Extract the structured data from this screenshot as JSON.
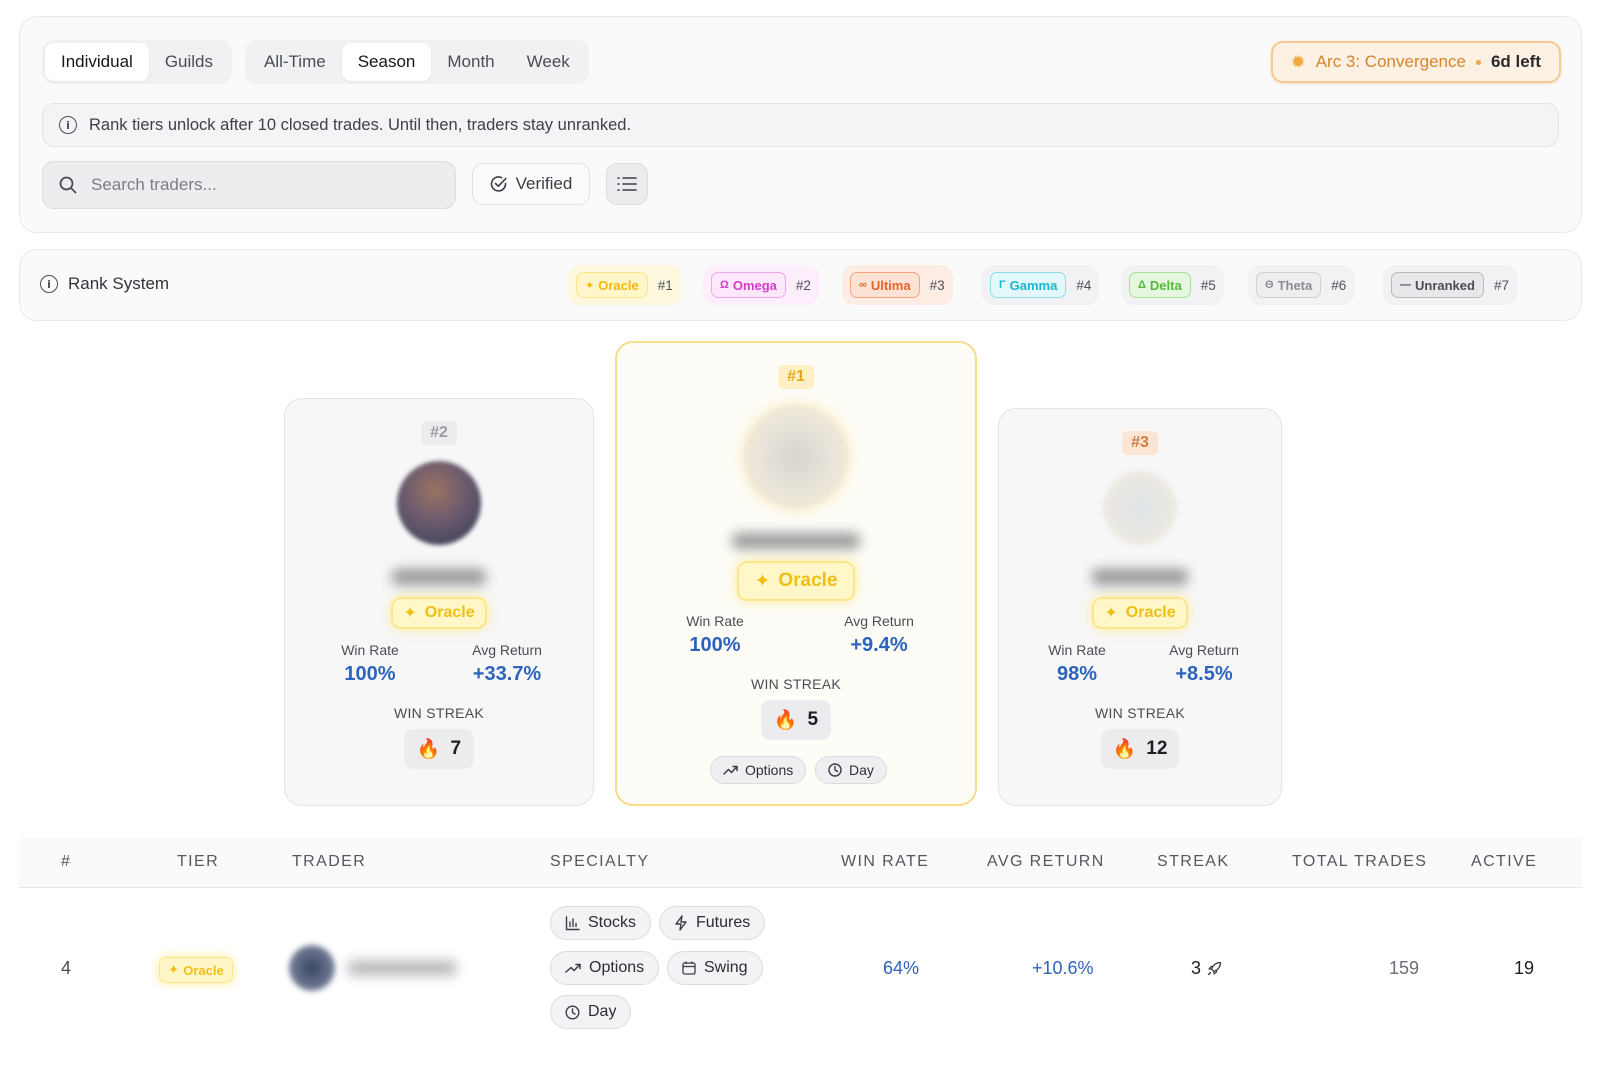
{
  "view_tabs": [
    "Individual",
    "Guilds"
  ],
  "view_active": 0,
  "period_tabs": [
    "All-Time",
    "Season",
    "Month",
    "Week"
  ],
  "period_active": 1,
  "arc": {
    "name": "Arc 3: Convergence",
    "time_left": "6d left"
  },
  "notice": "Rank tiers unlock after 10 closed trades. Until then, traders stay unranked.",
  "search": {
    "placeholder": "Search traders..."
  },
  "verified_label": "Verified",
  "rank_system": {
    "title": "Rank System",
    "tiers": [
      {
        "name": "Oracle",
        "glyph": "✦",
        "rank": "#1",
        "color": "#f5b70f",
        "bg": "#fff6c9",
        "border": "#fde68a"
      },
      {
        "name": "Omega",
        "glyph": "Ω",
        "rank": "#2",
        "color": "#d23ccb",
        "bg": "#fde8fb",
        "border": "#f0a6ea"
      },
      {
        "name": "Ultima",
        "glyph": "∞",
        "rank": "#3",
        "color": "#e8622a",
        "bg": "#fde3d6",
        "border": "#f6a37f"
      },
      {
        "name": "Gamma",
        "glyph": "Γ",
        "rank": "#4",
        "color": "#1ab6cf",
        "bg": "#e2f8fb",
        "border": "#8fdde9"
      },
      {
        "name": "Delta",
        "glyph": "Δ",
        "rank": "#5",
        "color": "#52b83a",
        "bg": "#e6f7df",
        "border": "#a7df95"
      },
      {
        "name": "Theta",
        "glyph": "Θ",
        "rank": "#6",
        "color": "#8a8d94",
        "bg": "#eeeef0",
        "border": "#cfd0d4"
      },
      {
        "name": "Unranked",
        "glyph": "—",
        "rank": "#7",
        "color": "#4a4d55",
        "bg": "#e8e8eb",
        "border": "#b8b9be"
      }
    ]
  },
  "podium": [
    {
      "rank": "#2",
      "tier": "Oracle",
      "win_rate_label": "Win Rate",
      "win_rate": "100%",
      "avg_return_label": "Avg Return",
      "avg_return": "+33.7%",
      "streak_label": "WIN STREAK",
      "streak": "7"
    },
    {
      "rank": "#1",
      "tier": "Oracle",
      "win_rate_label": "Win Rate",
      "win_rate": "100%",
      "avg_return_label": "Avg Return",
      "avg_return": "+9.4%",
      "streak_label": "WIN STREAK",
      "streak": "5",
      "tags": [
        "Options",
        "Day"
      ]
    },
    {
      "rank": "#3",
      "tier": "Oracle",
      "win_rate_label": "Win Rate",
      "win_rate": "98%",
      "avg_return_label": "Avg Return",
      "avg_return": "+8.5%",
      "streak_label": "WIN STREAK",
      "streak": "12"
    }
  ],
  "table": {
    "headers": [
      "#",
      "TIER",
      "TRADER",
      "SPECIALTY",
      "WIN RATE",
      "AVG RETURN",
      "STREAK",
      "TOTAL TRADES",
      "ACTIVE"
    ],
    "rows": [
      {
        "rank": "4",
        "tier": "Oracle",
        "specialties": [
          "Stocks",
          "Futures",
          "Options",
          "Swing",
          "Day"
        ],
        "win_rate": "64%",
        "avg_return": "+10.6%",
        "streak": "3",
        "total_trades": "159",
        "active": "19"
      }
    ]
  }
}
